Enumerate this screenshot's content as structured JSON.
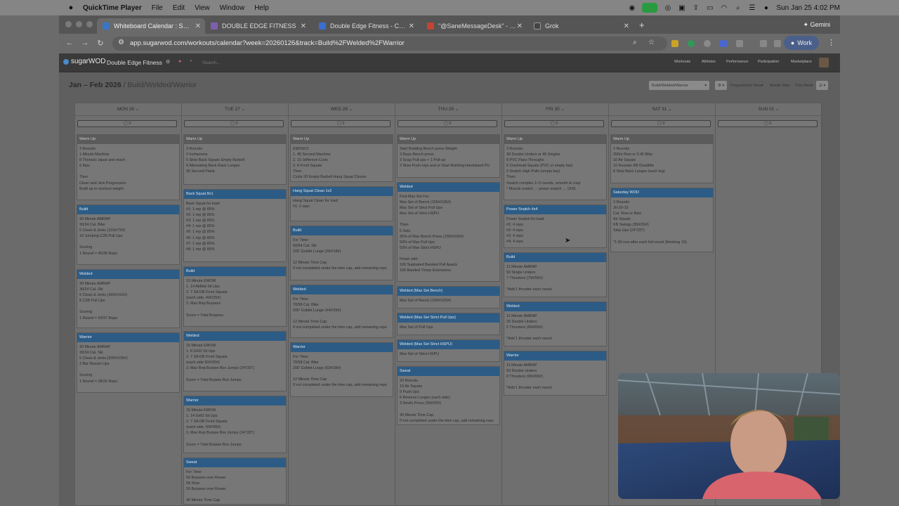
{
  "menubar": {
    "app_name": "QuickTime Player",
    "menus": [
      "File",
      "Edit",
      "View",
      "Window",
      "Help"
    ],
    "datetime": "Sun Jan 25  4:02 PM"
  },
  "browser": {
    "tabs": [
      {
        "label": "Whiteboard Calendar : Sugar",
        "color": "#3a76c5",
        "active": true
      },
      {
        "label": "DOUBLE EDGE FITNESS",
        "color": "#7d5fb0",
        "active": false
      },
      {
        "label": "Double Edge Fitness - Calenda",
        "color": "#3a6fd0",
        "active": false
      },
      {
        "label": "\"@SaneMessageDesk\" - dene",
        "color": "#c5442f",
        "active": false
      },
      {
        "label": "Grok",
        "color": "#444444",
        "active": false
      }
    ],
    "gemini_label": "Gemini",
    "url": "app.sugarwod.com/workouts/calendar?week=20260126&track=Build%2FWelded%2FWarrior",
    "profile_label": "Work"
  },
  "app": {
    "logo": "sugarWOD",
    "gym_name": "Double Edge Fitness",
    "search_placeholder": "Search...",
    "nav": [
      "Workouts",
      "Athletes",
      "Performance",
      "Participation",
      "Marketplace"
    ]
  },
  "page": {
    "date_range": "Jan – Feb 2026",
    "track": "Build/Welded/Warrior",
    "track_select": "Build/Welded/Warrior",
    "view_buttons": [
      "Programmer View",
      "Month View",
      "This Week"
    ]
  },
  "days": [
    {
      "label": "MON 26",
      "comments": "0",
      "cards": [
        {
          "title": "Warm Up",
          "style": "gray",
          "lines": [
            "3 Rounds",
            "1 Minute Machine",
            "8 Thoracic squat and reach",
            "6 Kips",
            "",
            "Then",
            "Clean and Jerk Progression",
            "Build up to workout weight."
          ]
        },
        {
          "title": "Build",
          "style": "blue",
          "lines": [
            "30 Minute AMRAP",
            "30/24 Cal. Bike",
            "5 Clean & Jerks (115#/75#)",
            "10 Jumping C2B Pull Ups",
            "",
            "Scoring",
            "1 Round = 45/39 Reps"
          ]
        },
        {
          "title": "Welded",
          "style": "blue",
          "lines": [
            "30 Minute AMRAP",
            "30/24 Cal. Ski",
            "5 Clean & Jerks (165#/115#)",
            "8 C2B Pull Ups",
            "",
            "Scoring",
            "1 Round = 43/37 Reps"
          ]
        },
        {
          "title": "Warrior",
          "style": "blue",
          "lines": [
            "30 Minute AMRAP",
            "30/24 Cal. Ski",
            "5 Clean & Jerks (205#/135#)",
            "3 Bar Muscle Ups",
            "",
            "Scoring",
            "1 Round = 38/32 Reps"
          ]
        }
      ]
    },
    {
      "label": "TUE 27",
      "comments": "0",
      "cards": [
        {
          "title": "Warm Up",
          "style": "gray",
          "lines": [
            "3 Rounds",
            "4 Inchworms",
            "5 Slow Back Squats Empty Barbell",
            "6 Alternating Back Rack Lunges",
            "30 Second Plank"
          ]
        },
        {
          "title": "Back Squat 8x1",
          "style": "blue",
          "lines": [
            "Back Squat for load:",
            "#1: 1 rep @ 85%",
            "#2: 1 rep @ 85%",
            "#3: 1 rep @ 85%",
            "#4: 1 rep @ 85%",
            "#5: 1 rep @ 85%",
            "#6: 1 rep @ 85%",
            "#7: 1 rep @ 85%",
            "#8: 1 rep @ 85%"
          ]
        },
        {
          "title": "Build",
          "style": "blue",
          "lines": [
            "15 Minute EMOM",
            "1. 14 AbMat Sit Ups",
            "2. 7 SA DB Front Squats",
            "(each side, 40#/25#)",
            "3. Max Rep Burpees",
            "",
            "Score = Total Burpees"
          ]
        },
        {
          "title": "Welded",
          "style": "blue",
          "lines": [
            "15 Minute EMOM",
            "1. 8 GHD Sit Ups",
            "2. 7 SA DB Front Squats",
            "(each side 50#/35#)",
            "3. Max Rep Burpee Box Jumps (24\"/20\")",
            "",
            "Score = Total Burpee Box Jumps"
          ]
        },
        {
          "title": "Warrior",
          "style": "blue",
          "lines": [
            "15 Minute EMOM",
            "1. 14 GHD Sit Ups",
            "2. 7 SA DB Front Squats",
            "(each side, 60#/45#)",
            "3. Max Rep Burpee Box Jumps (24\"/20\")",
            "",
            "Score = Total Burpee Box Jumps"
          ]
        },
        {
          "title": "Sweat",
          "style": "blue",
          "lines": [
            "For Time:",
            "50 Burpees over Rower",
            "5K Row",
            "50 Burpees over Rower",
            "",
            "45 Minute Time Cap"
          ]
        }
      ]
    },
    {
      "label": "WED 28",
      "comments": "0",
      "cards": [
        {
          "title": "Warm Up",
          "style": "gray",
          "lines": [
            "EMOM12",
            "1. 45 Second Machine",
            "2. 10 Jefferson Curls",
            "3. 8 Front Squats",
            "Then",
            "Cycle 20 Empty Barbell Hang Squat Cleans"
          ]
        },
        {
          "title": "Hang Squat Clean 1x2",
          "style": "blue",
          "lines": [
            "Hang Squat Clean for load:",
            "#1: 2 reps"
          ]
        },
        {
          "title": "Build",
          "style": "blue",
          "lines": [
            "For Time:",
            "60/54 Cal. Ski",
            "200' Goblet Lunge (26#/18#)",
            "",
            "12 Minute Time Cap",
            "If not completed under the time cap, add remaining reps"
          ]
        },
        {
          "title": "Welded",
          "style": "blue",
          "lines": [
            "For Time:",
            "70/58 Cal. Bike",
            "200' Goblet Lunge (44#/26#)",
            "",
            "12 Minute Time Cap",
            "If not completed under the time cap, add remaining reps"
          ]
        },
        {
          "title": "Warrior",
          "style": "blue",
          "lines": [
            "For Time:",
            "70/58 Cal. Bike",
            "200' Goblet Lunge (53#/35#)",
            "",
            "12 Minute Time Cap",
            "If not completed under the time cap, add remaining reps"
          ]
        }
      ]
    },
    {
      "label": "THU 29",
      "comments": "0",
      "cards": [
        {
          "title": "Warm Up",
          "style": "gray",
          "lines": [
            "Start Building Bench press Weight",
            "3 Reps Bench press",
            "3 Scap Pull-ups + 1 Pull-up",
            "3 Slow Push-Ups and or Start Building Handstand PU"
          ]
        },
        {
          "title": "Welded",
          "style": "blue",
          "lines": [
            "Find Max Set For:",
            "Max Set of Bench (155#/105#)",
            "Max Set of Strict Pull Ups",
            "Max Set of Strict HSPU",
            "",
            "Then:",
            "5 Sets",
            "35% of Max Bench Press (155#/105#)",
            "50% of Max Pull Ups",
            "50% of Max Strict HSPU",
            "",
            "Finish with:",
            "100 Supinated Banded Pull Aparts",
            "100 Banded Tricep Extensions"
          ]
        },
        {
          "title": "Welded (Max Set Bench)",
          "style": "blue",
          "lines": [
            "Max Set of Bench (155#/105#)"
          ]
        },
        {
          "title": "Welded (Max Set Strict Pull Ups)",
          "style": "blue",
          "lines": [
            "Max Set of Pull Ups"
          ]
        },
        {
          "title": "Welded (Max Set Strict HSPU)",
          "style": "blue",
          "lines": [
            "Max Set of Strict HSPU"
          ]
        },
        {
          "title": "Sweat",
          "style": "blue",
          "lines": [
            "20 Rounds",
            "15 Air Squats",
            "9 Push Ups",
            "6 Reverse Lunges (each side)",
            "3 Devils Press (30#/20#)",
            "",
            "35 Minute Time Cap",
            "If not completed under the time cap, add remaining reps"
          ]
        }
      ]
    },
    {
      "label": "FRI 30",
      "comments": "0",
      "cards": [
        {
          "title": "Warm Up",
          "style": "gray",
          "lines": [
            "3 Rounds:",
            "30 Double Unders or 45 Singles",
            "8 PVC Pass-Throughs",
            "6 Overhead Squats (PVC or empty bar)",
            "6 Snatch High Pulls (empty bar)",
            "Then:",
            "Snatch complex 2–3 rounds, smooth & crisp",
            "* Muscle snatch → power snatch → OHS"
          ]
        },
        {
          "title": "Power Snatch 4x4",
          "style": "blue",
          "lines": [
            "Power Snatch for load:",
            "#1: 4 reps",
            "#2: 4 reps",
            "#3: 4 reps",
            "#4: 4 reps"
          ]
        },
        {
          "title": "Build",
          "style": "blue",
          "lines": [
            "11 Minute AMRAP",
            "50 Single Unders",
            "7 Thrusters (75#/55#)",
            "",
            "*Add 1 thruster each round."
          ]
        },
        {
          "title": "Welded",
          "style": "blue",
          "lines": [
            "11 Minute AMRAP",
            "25 Double Unders",
            "5 Thrusters (95#/65#)",
            "",
            "*Add 1 thruster each round."
          ]
        },
        {
          "title": "Warrior",
          "style": "blue",
          "lines": [
            "11 Minute AMRAP",
            "50 Double Unders",
            "8 Thrusters (95#/65#)",
            "",
            "*Add 1 thruster each round."
          ]
        }
      ]
    },
    {
      "label": "SAT 31",
      "comments": "0",
      "cards": [
        {
          "title": "Warm Up",
          "style": "gray",
          "lines": [
            "2 Rounds",
            "250m Row or 0.45 Bike",
            "10 Air Squats",
            "10 Russian KB Deadlifts",
            "8 Step Back Lunges (each leg)"
          ]
        },
        {
          "title": "Saturday WOD",
          "style": "blue",
          "lines": [
            "3 Rounds",
            "30-20-10",
            "Cal. Row or Bike",
            "Air Squats",
            "KB Swings (35#/26#)",
            "Step Ups (24\"/20\")",
            "",
            "*1:00 rest after each full round (finishing 10)."
          ]
        }
      ]
    },
    {
      "label": "SUN 01",
      "comments": "0",
      "cards": []
    }
  ]
}
